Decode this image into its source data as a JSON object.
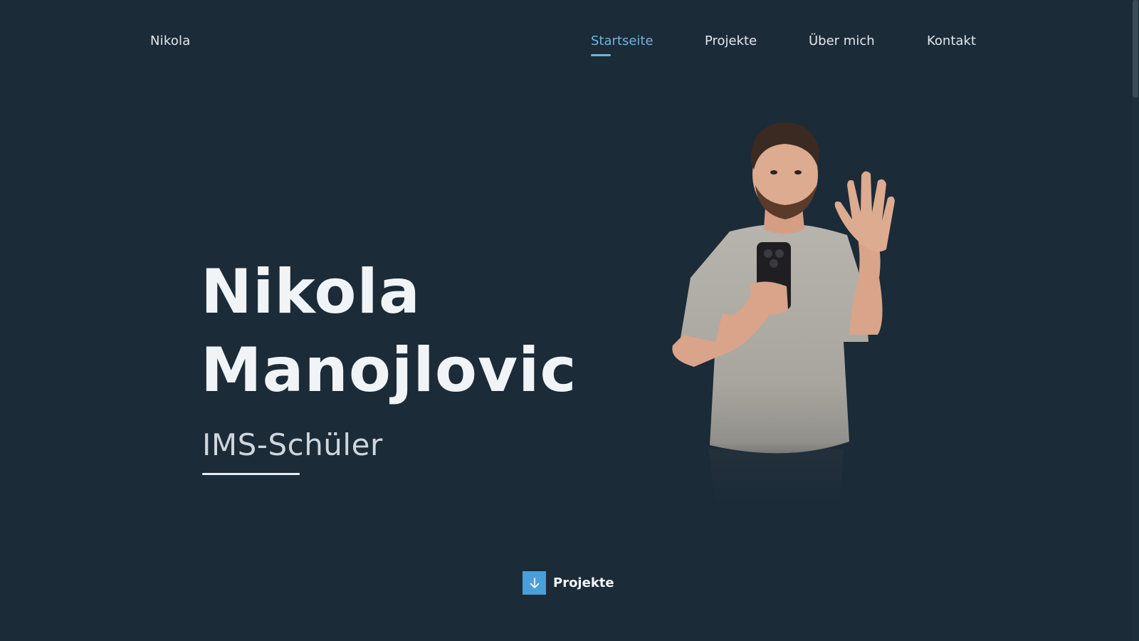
{
  "header": {
    "brand": "Nikola",
    "nav": [
      {
        "label": "Startseite",
        "active": true
      },
      {
        "label": "Projekte",
        "active": false
      },
      {
        "label": "Über mich",
        "active": false
      },
      {
        "label": "Kontakt",
        "active": false
      }
    ]
  },
  "hero": {
    "first_name": "Nikola",
    "last_name": "Manojlovic",
    "subtitle": "IMS-Schüler"
  },
  "scroll_button": {
    "label": "Projekte",
    "icon": "arrow-down-icon"
  },
  "colors": {
    "background": "#1b2b38",
    "accent": "#6fb4e0",
    "button": "#4a9fd8"
  }
}
